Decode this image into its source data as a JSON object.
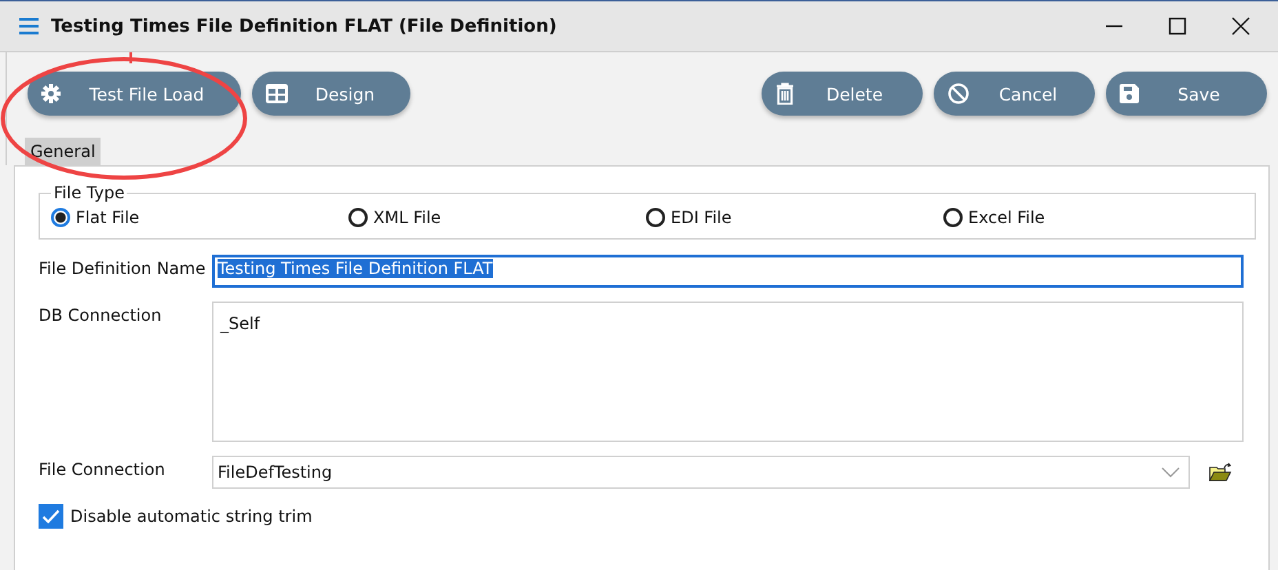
{
  "window": {
    "title": "Testing Times File Definition FLAT (File Definition)"
  },
  "toolbar": {
    "left_buttons": [
      {
        "label": "Test File Load",
        "kind": "gear"
      },
      {
        "label": "Design",
        "kind": "grid"
      }
    ],
    "right_buttons": [
      {
        "label": "Delete",
        "kind": "trash"
      },
      {
        "label": "Cancel",
        "kind": "cancel"
      },
      {
        "label": "Save",
        "kind": "disk"
      }
    ]
  },
  "tabs": [
    {
      "label": "General",
      "selected": true
    }
  ],
  "file_type": {
    "legend": "File Type",
    "options": [
      {
        "label": "Flat File",
        "selected": true
      },
      {
        "label": "XML File",
        "selected": false
      },
      {
        "label": "EDI File",
        "selected": false
      },
      {
        "label": "Excel File",
        "selected": false
      }
    ]
  },
  "fields": [
    {
      "kind": "text",
      "label": "File Definition Name",
      "value": "Testing Times File Definition FLAT"
    },
    {
      "kind": "textarea",
      "label": "DB Connection",
      "value": "_Self"
    },
    {
      "kind": "select",
      "label": "File Connection",
      "value": "FileDefTesting"
    }
  ],
  "checkbox": {
    "label": "Disable automatic string trim",
    "checked": true
  }
}
